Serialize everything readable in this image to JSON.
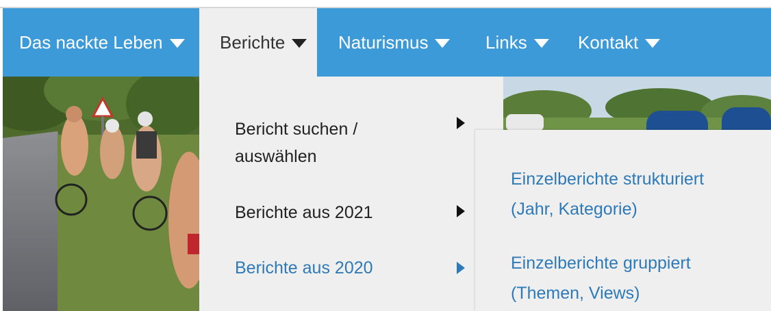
{
  "nav": {
    "items": [
      {
        "label": "Das nackte Leben"
      },
      {
        "label": "Berichte"
      },
      {
        "label": "Naturismus"
      },
      {
        "label": "Links"
      },
      {
        "label": "Kontakt"
      }
    ]
  },
  "dropdown": {
    "items": [
      {
        "label_line1": "Bericht suchen /",
        "label_line2": "auswählen"
      },
      {
        "label": "Berichte aus 2021"
      },
      {
        "label": "Berichte aus 2020"
      }
    ]
  },
  "submenu": {
    "items": [
      {
        "label_line1": "Einzelberichte strukturiert",
        "label_line2": "(Jahr, Kategorie)"
      },
      {
        "label_line1": "Einzelberichte gruppiert",
        "label_line2": "(Themen, Views)"
      }
    ]
  },
  "colors": {
    "nav_bg": "#3d9ad9",
    "dropdown_bg": "#efefef",
    "link_blue": "#2e7ab8"
  }
}
